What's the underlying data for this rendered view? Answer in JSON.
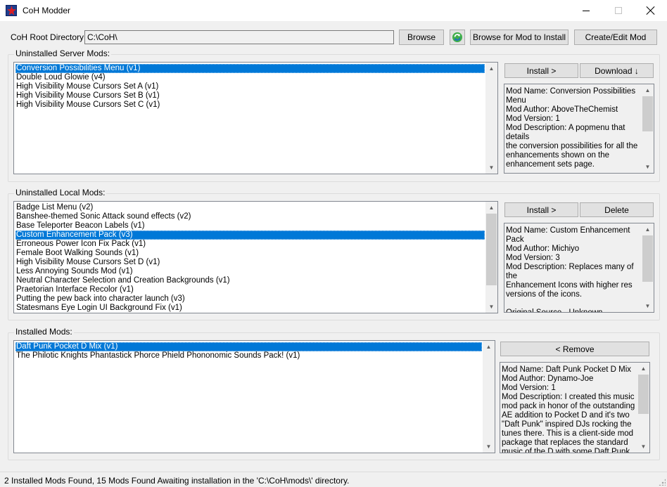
{
  "window": {
    "title": "CoH Modder"
  },
  "toolbar": {
    "root_label": "CoH Root Directory:",
    "root_value": "C:\\CoH\\",
    "browse": "Browse",
    "browse_mod": "Browse for Mod to Install",
    "create_edit": "Create/Edit Mod"
  },
  "server_mods": {
    "label": "Uninstalled Server Mods:",
    "items": [
      "Conversion Possibilities Menu (v1)",
      "Double Loud Glowie (v4)",
      "High Visibility Mouse Cursors Set A (v1)",
      "High Visibility Mouse Cursors Set B (v1)",
      "High Visibility Mouse Cursors Set C (v1)"
    ],
    "selected_index": 0,
    "install": "Install >",
    "download": "Download ↓",
    "description": "Mod Name: Conversion Possibilities\nMenu\nMod Author: AboveTheChemist\nMod Version: 1\nMod Description: A popmenu that details\nthe conversion possibilities for all the\nenhancements shown on the\nenhancement sets page.\n\nOriginal Source:"
  },
  "local_mods": {
    "label": "Uninstalled Local Mods:",
    "items": [
      "Badge List Menu (v2)",
      "Banshee-themed Sonic Attack sound effects (v2)",
      "Base Teleporter Beacon Labels (v1)",
      "Custom Enhancement Pack (v3)",
      "Erroneous Power Icon Fix Pack (v1)",
      "Female Boot Walking Sounds (v1)",
      "High Visibility Mouse Cursors Set D (v1)",
      "Less Annoying Sounds Mod (v1)",
      "Neutral Character Selection and Creation Backgrounds (v1)",
      "Praetorian Interface Recolor (v1)",
      "Putting the pew back into character launch (v3)",
      "Statesmans Eye Login UI Background Fix (v1)"
    ],
    "selected_index": 3,
    "install": "Install >",
    "delete": "Delete",
    "description": "Mod Name: Custom Enhancement Pack\nMod Author: Michiyo\nMod Version: 3\nMod Description: Replaces many of the\nEnhancement Icons with higher res\nversions of the icons.\n\nOriginal Source - Unknown\n\nRepackaged by Westley Bennett"
  },
  "installed_mods": {
    "label": "Installed Mods:",
    "items": [
      "Daft Punk Pocket D Mix (v1)",
      "The Philotic Knights Phantastick Phorce Phield Phononomic Sounds Pack! (v1)"
    ],
    "selected_index": 0,
    "remove": "< Remove",
    "description": "Mod Name: Daft Punk Pocket D Mix\nMod Author: Dynamo-Joe\nMod Version: 1\nMod Description: I created this music\nmod pack in honor of the outstanding\nAE addition to Pocket D and it's two\n\"Daft Punk\" inspired DJs rocking the\ntunes there. This is a client-side mod\npackage that replaces the standard\nmusic of the D with some Daft Punk"
  },
  "status": {
    "text": "2 Installed Mods Found, 15 Mods Found Awaiting installation in the 'C:\\CoH\\mods\\' directory."
  },
  "icons": {
    "app": "star-shield-icon",
    "refresh": "refresh-icon",
    "accent": "#0078d7"
  }
}
